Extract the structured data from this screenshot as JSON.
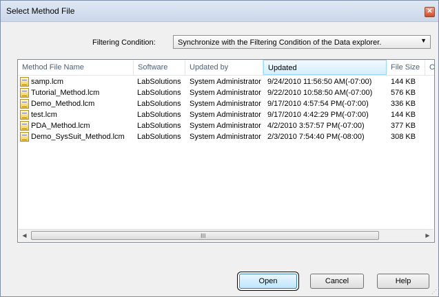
{
  "window": {
    "title": "Select Method File",
    "close_glyph": "✕"
  },
  "filter": {
    "label": "Filtering Condition:",
    "value": "Synchronize with the Filtering Condition of the Data explorer."
  },
  "table": {
    "columns": [
      "Method File Name",
      "Software",
      "Updated by",
      "Updated",
      "File Size",
      "C"
    ],
    "sorted_column": "Updated",
    "rows": [
      {
        "name": "samp.lcm",
        "software": "LabSolutions",
        "updated_by": "System Administrator",
        "updated": "9/24/2010 11:56:50 AM(-07:00)",
        "size": "144 KB"
      },
      {
        "name": "Tutorial_Method.lcm",
        "software": "LabSolutions",
        "updated_by": "System Administrator",
        "updated": "9/22/2010 10:58:50 AM(-07:00)",
        "size": "576 KB"
      },
      {
        "name": "Demo_Method.lcm",
        "software": "LabSolutions",
        "updated_by": "System Administrator",
        "updated": "9/17/2010 4:57:54 PM(-07:00)",
        "size": "336 KB"
      },
      {
        "name": "test.lcm",
        "software": "LabSolutions",
        "updated_by": "System Administrator",
        "updated": "9/17/2010 4:42:29 PM(-07:00)",
        "size": "144 KB"
      },
      {
        "name": "PDA_Method.lcm",
        "software": "LabSolutions",
        "updated_by": "System Administrator",
        "updated": "4/2/2010 3:57:57 PM(-07:00)",
        "size": "377 KB"
      },
      {
        "name": "Demo_SysSuit_Method.lcm",
        "software": "LabSolutions",
        "updated_by": "System Administrator",
        "updated": "2/3/2010 7:54:40 PM(-08:00)",
        "size": "308 KB"
      }
    ]
  },
  "scrollbar": {
    "left_arrow": "◀",
    "right_arrow": "▶",
    "grip": "III"
  },
  "buttons": {
    "open": "Open",
    "cancel": "Cancel",
    "help": "Help"
  },
  "colors": {
    "accent": "#3c7fb1",
    "sorted_header": "#d6eefb"
  }
}
